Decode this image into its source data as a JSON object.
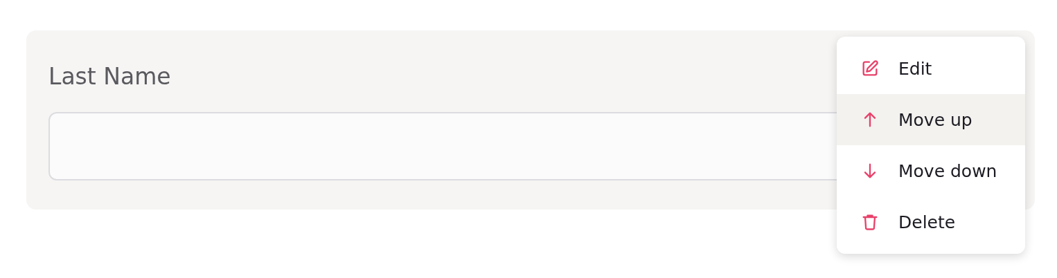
{
  "field": {
    "label": "Last Name"
  },
  "menu": {
    "items": [
      {
        "kind": "edit",
        "label": "Edit",
        "highlighted": false
      },
      {
        "kind": "up",
        "label": "Move up",
        "highlighted": true
      },
      {
        "kind": "down",
        "label": "Move down",
        "highlighted": false
      },
      {
        "kind": "delete",
        "label": "Delete",
        "highlighted": false
      }
    ]
  }
}
